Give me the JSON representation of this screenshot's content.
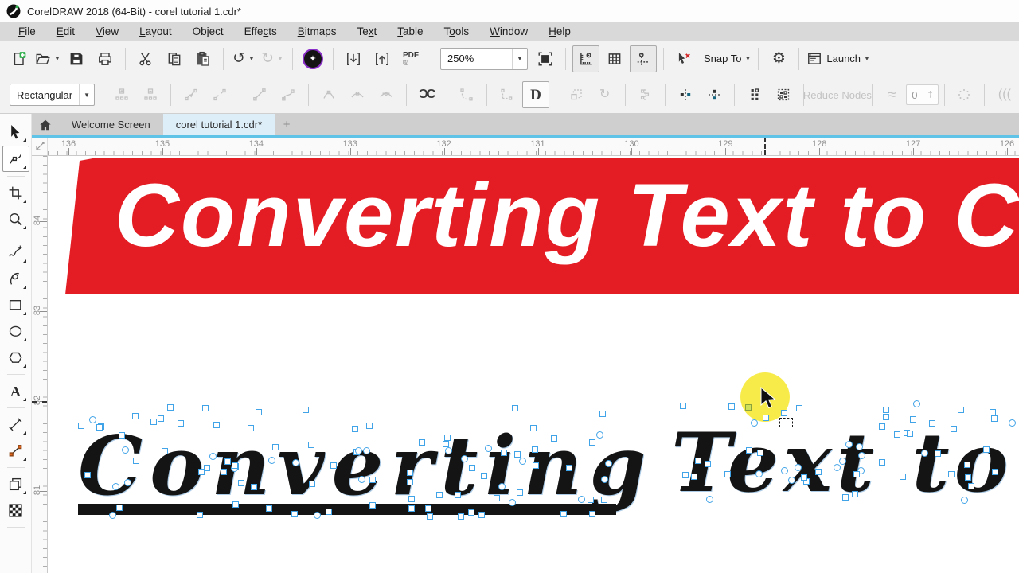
{
  "window": {
    "title": "CorelDRAW 2018 (64-Bit) - corel tutorial 1.cdr*"
  },
  "colors": {
    "banner_red": "#e41c24",
    "node_blue": "#42a4e8",
    "highlight_yellow": "#f3ea3c",
    "accent_cyan": "#5fc3e7"
  },
  "menu": {
    "items": [
      {
        "label": "File",
        "m": 0
      },
      {
        "label": "Edit",
        "m": 0
      },
      {
        "label": "View",
        "m": 0
      },
      {
        "label": "Layout",
        "m": 0
      },
      {
        "label": "Object",
        "m": 2
      },
      {
        "label": "Effects",
        "m": 4
      },
      {
        "label": "Bitmaps",
        "m": 0
      },
      {
        "label": "Text",
        "m": 2
      },
      {
        "label": "Table",
        "m": 0
      },
      {
        "label": "Tools",
        "m": 1
      },
      {
        "label": "Window",
        "m": 0
      },
      {
        "label": "Help",
        "m": 0
      }
    ]
  },
  "toolbar": {
    "zoom_level": "250%",
    "buttons": [
      {
        "type": "btn",
        "name": "new-document-button",
        "icon": "new"
      },
      {
        "type": "btn",
        "name": "open-button",
        "icon": "open",
        "dropdown": true
      },
      {
        "type": "btn",
        "name": "save-button",
        "icon": "save"
      },
      {
        "type": "btn",
        "name": "print-button",
        "icon": "print"
      },
      {
        "type": "sep"
      },
      {
        "type": "btn",
        "name": "cut-button",
        "icon": "cut"
      },
      {
        "type": "btn",
        "name": "copy-button",
        "icon": "copy"
      },
      {
        "type": "btn",
        "name": "paste-button",
        "icon": "paste"
      },
      {
        "type": "sep"
      },
      {
        "type": "btn",
        "name": "undo-button",
        "icon": "undo",
        "dropdown": true
      },
      {
        "type": "btn",
        "name": "redo-button",
        "icon": "redo",
        "dropdown": true,
        "disabled": true
      },
      {
        "type": "sep"
      },
      {
        "type": "btn",
        "name": "search-content-button",
        "icon": "search"
      },
      {
        "type": "sep"
      },
      {
        "type": "btn",
        "name": "import-button",
        "icon": "import"
      },
      {
        "type": "btn",
        "name": "export-button",
        "icon": "export"
      },
      {
        "type": "btn",
        "name": "publish-pdf-button",
        "icon": "pdf",
        "label": "PDF"
      },
      {
        "type": "sep"
      },
      {
        "type": "combo",
        "name": "zoom-level-combobox",
        "value": "250%"
      },
      {
        "type": "btn",
        "name": "fullscreen-preview-button",
        "icon": "fullscreen"
      },
      {
        "type": "sep"
      },
      {
        "type": "btn",
        "name": "show-rulers-toggle",
        "icon": "rulers",
        "pressed": true
      },
      {
        "type": "btn",
        "name": "show-grid-toggle",
        "icon": "grid"
      },
      {
        "type": "btn",
        "name": "show-guidelines-toggle",
        "icon": "guidelines",
        "pressed": true
      },
      {
        "type": "sep"
      },
      {
        "type": "btn",
        "name": "snap-off-button",
        "icon": "snapoff"
      },
      {
        "type": "btn",
        "name": "snap-to-dropdown",
        "label": "Snap To",
        "dropdown": true
      },
      {
        "type": "sep"
      },
      {
        "type": "btn",
        "name": "options-button",
        "icon": "gear"
      },
      {
        "type": "sep"
      },
      {
        "type": "btn",
        "name": "launch-dropdown",
        "icon": "launch",
        "label": "Launch",
        "dropdown": true
      }
    ]
  },
  "property_bar": {
    "selection_mode": "Rectangular",
    "reduce_nodes_label": "Reduce Nodes",
    "smoothness_value": "0",
    "items": [
      {
        "type": "combo",
        "name": "selection-mode-combobox",
        "value": "Rectangular"
      },
      {
        "type": "gap"
      },
      {
        "type": "btn",
        "name": "add-nodes-button",
        "icon": "addnode",
        "disabled": true
      },
      {
        "type": "btn",
        "name": "delete-nodes-button",
        "icon": "delnode",
        "disabled": true
      },
      {
        "type": "sep"
      },
      {
        "type": "btn",
        "name": "join-nodes-button",
        "icon": "joinnode",
        "disabled": true
      },
      {
        "type": "btn",
        "name": "break-curve-button",
        "icon": "breaknode",
        "disabled": true
      },
      {
        "type": "sep"
      },
      {
        "type": "btn",
        "name": "convert-to-line-button",
        "icon": "toline",
        "disabled": true
      },
      {
        "type": "btn",
        "name": "convert-to-curve-button",
        "icon": "tocurve",
        "disabled": true
      },
      {
        "type": "sep"
      },
      {
        "type": "btn",
        "name": "cusp-node-button",
        "icon": "cusp",
        "disabled": true
      },
      {
        "type": "btn",
        "name": "smooth-node-button",
        "icon": "smoothn",
        "disabled": true
      },
      {
        "type": "btn",
        "name": "symmetrical-node-button",
        "icon": "symm",
        "disabled": true
      },
      {
        "type": "sep"
      },
      {
        "type": "btn",
        "name": "reverse-direction-button",
        "icon": "reverse"
      },
      {
        "type": "sep"
      },
      {
        "type": "btn",
        "name": "extract-subpath-button",
        "icon": "extract",
        "disabled": true
      },
      {
        "type": "sep"
      },
      {
        "type": "btn",
        "name": "extend-curve-close-button",
        "icon": "extend",
        "disabled": true
      },
      {
        "type": "btn",
        "name": "close-curve-button",
        "icon": "closecurve",
        "boxed": true
      },
      {
        "type": "sep"
      },
      {
        "type": "btn",
        "name": "stretch-nodes-button",
        "icon": "stretch",
        "disabled": true
      },
      {
        "type": "btn",
        "name": "rotate-nodes-button",
        "icon": "rotaten",
        "disabled": true
      },
      {
        "type": "sep"
      },
      {
        "type": "btn",
        "name": "align-nodes-button",
        "icon": "alignn",
        "disabled": true
      },
      {
        "type": "sep"
      },
      {
        "type": "btn",
        "name": "reflect-nodes-horizontal-button",
        "icon": "reflecth"
      },
      {
        "type": "btn",
        "name": "reflect-nodes-vertical-button",
        "icon": "reflectv"
      },
      {
        "type": "sep"
      },
      {
        "type": "btn",
        "name": "elastic-mode-button",
        "icon": "elastic"
      },
      {
        "type": "btn",
        "name": "select-all-nodes-button",
        "icon": "selectall"
      },
      {
        "type": "sep"
      },
      {
        "type": "textbtn",
        "name": "reduce-nodes-button",
        "label": "Reduce Nodes",
        "disabled": true
      },
      {
        "type": "sep"
      },
      {
        "type": "btn",
        "name": "curve-smoothness-button",
        "icon": "wave",
        "disabled": true
      },
      {
        "type": "spin",
        "name": "curve-smoothness-input",
        "value": "0"
      },
      {
        "type": "sep"
      },
      {
        "type": "btn",
        "name": "smooth-region-button",
        "icon": "dots",
        "disabled": true
      },
      {
        "type": "sep"
      },
      {
        "type": "btn",
        "name": "arc-settings-button",
        "icon": "arcs",
        "disabled": true
      }
    ]
  },
  "tabs": {
    "new_tab_label": "+",
    "items": [
      {
        "label": "Welcome Screen",
        "active": false
      },
      {
        "label": "corel tutorial 1.cdr*",
        "active": true
      }
    ]
  },
  "rulers": {
    "horizontal": [
      "136",
      "135",
      "134",
      "133",
      "132",
      "131",
      "130",
      "129",
      "128",
      "127",
      "126"
    ],
    "vertical": [
      "84",
      "83",
      "82",
      "81"
    ]
  },
  "toolbox": {
    "tools": [
      {
        "name": "pick-tool",
        "icon": "pick",
        "flyout": true
      },
      {
        "name": "shape-tool",
        "icon": "shape",
        "flyout": true,
        "selected": true
      },
      {
        "type": "sep"
      },
      {
        "name": "crop-tool",
        "icon": "crop",
        "flyout": true
      },
      {
        "name": "zoom-tool",
        "icon": "zoomt",
        "flyout": true
      },
      {
        "type": "sep"
      },
      {
        "name": "freehand-tool",
        "icon": "freehand",
        "flyout": true
      },
      {
        "name": "artistic-media-tool",
        "icon": "artistic",
        "flyout": true
      },
      {
        "name": "rectangle-tool",
        "icon": "rectt",
        "flyout": true
      },
      {
        "name": "ellipse-tool",
        "icon": "ellipset",
        "flyout": true
      },
      {
        "name": "polygon-tool",
        "icon": "polygont",
        "flyout": true
      },
      {
        "type": "sep"
      },
      {
        "name": "text-tool",
        "icon": "textt",
        "flyout": true
      },
      {
        "type": "sep"
      },
      {
        "name": "dimension-tool",
        "icon": "dimension",
        "flyout": true
      },
      {
        "name": "connector-tool",
        "icon": "connector",
        "flyout": true
      },
      {
        "type": "sep"
      },
      {
        "name": "drop-shadow-tool",
        "icon": "dropshadow",
        "flyout": true
      },
      {
        "name": "transparency-tool",
        "icon": "transparency"
      },
      {
        "type": "sep"
      }
    ]
  },
  "canvas": {
    "banner_text": "Converting Text to C",
    "word1": "Converting",
    "word2": "Text to"
  }
}
